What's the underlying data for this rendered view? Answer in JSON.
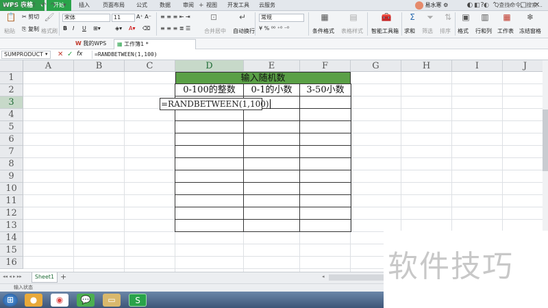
{
  "app": {
    "name": "WPS 表格"
  },
  "menu": {
    "tabs": [
      "开始",
      "插入",
      "页面布局",
      "公式",
      "数据",
      "审阅",
      "视图",
      "开发工具",
      "云服务"
    ]
  },
  "user": {
    "name": "易水寒"
  },
  "ribbon": {
    "paste": "粘贴",
    "cut": "剪切",
    "copy": "复制",
    "format_painter": "格式刷",
    "font": "宋体",
    "size": "11",
    "merge_center": "合并居中",
    "wrap_text": "自动换行",
    "number_format": "常规",
    "cond_format": "条件格式",
    "table_style": "表格样式",
    "smart_toolbox": "智能工具箱",
    "sum": "求和",
    "filter": "筛选",
    "sort": "排序",
    "format": "格式",
    "rows_cols": "行和列",
    "worksheet": "工作表",
    "freeze": "冻结窗格"
  },
  "doc_tabs": {
    "mywps": "我的WPS",
    "workbook": "工作簿1 *"
  },
  "search": {
    "placeholder": "Q查找命令、搜索..."
  },
  "formula_bar": {
    "name_box": "SUMPRODUCT",
    "fx": "fx",
    "formula": "=RANDBETWEEN(1,100)"
  },
  "columns": [
    "A",
    "B",
    "C",
    "D",
    "E",
    "F",
    "G",
    "H",
    "I",
    "J"
  ],
  "rows": [
    "1",
    "2",
    "3",
    "4",
    "5",
    "6",
    "7",
    "8",
    "9",
    "10",
    "11",
    "12",
    "13",
    "14",
    "15",
    "16"
  ],
  "table": {
    "title": "输入随机数",
    "headers": [
      "0-100的整数",
      "0-1的小数",
      "3-50小数"
    ],
    "edit_value": "=RANDBETWEEN(1,100)"
  },
  "sheets": [
    "Sheet1"
  ],
  "status": {
    "mode": "输入状态"
  },
  "watermark": "软件技巧",
  "colors": {
    "accent": "#29a34a",
    "header_fill": "#5aa046"
  }
}
